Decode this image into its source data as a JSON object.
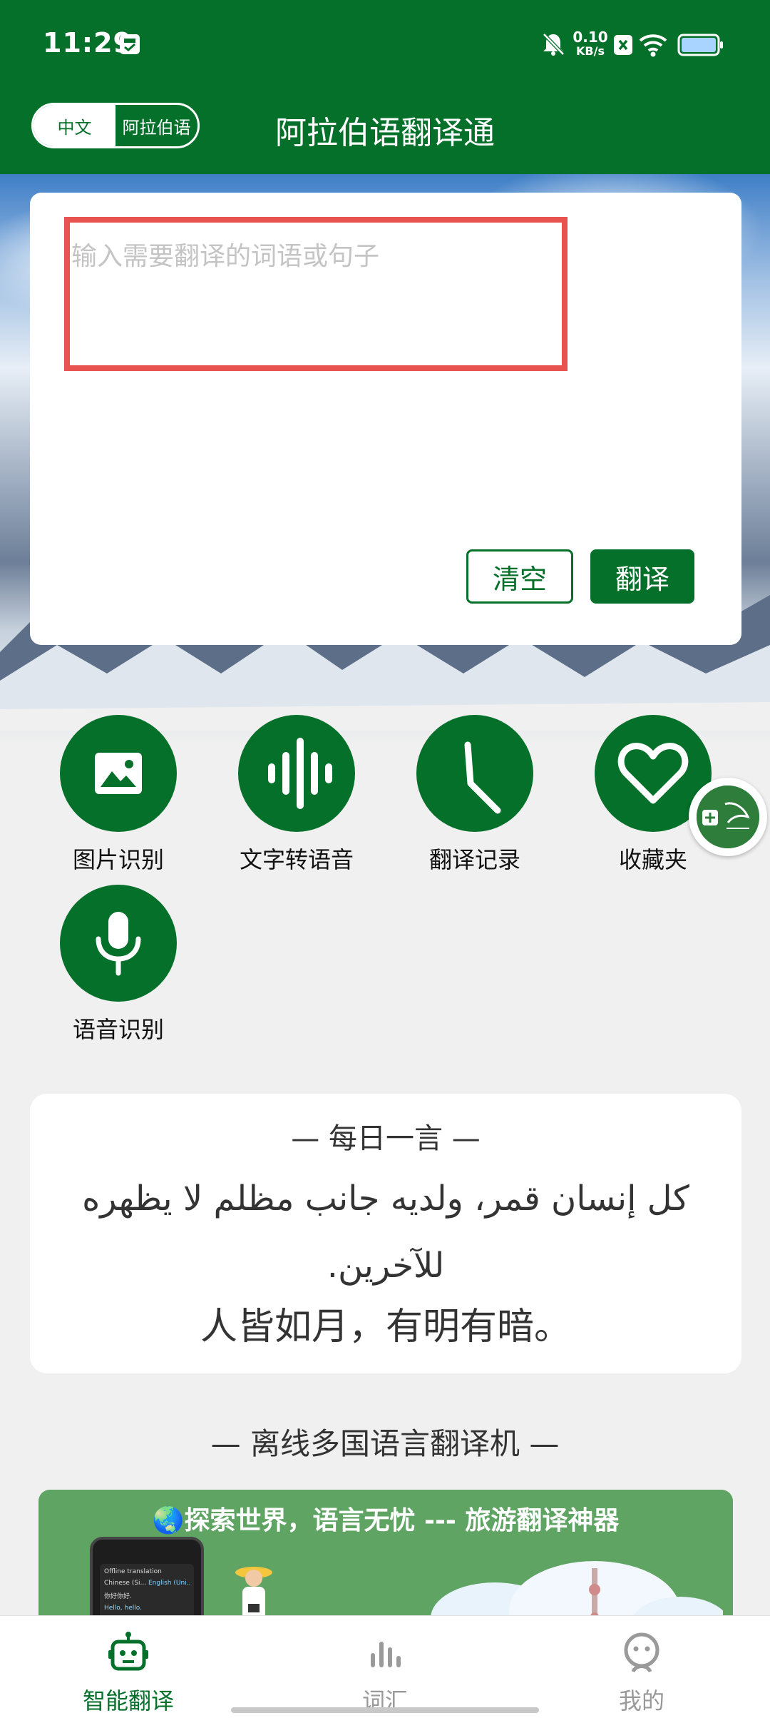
{
  "status_bar": {
    "time": "11:29",
    "net_speed_value": "0.10",
    "net_speed_unit": "KB/s"
  },
  "app_bar": {
    "lang_options": [
      "中文",
      "阿拉伯语"
    ],
    "active_lang_index": 0,
    "title": "阿拉伯语翻译通"
  },
  "input_card": {
    "placeholder": "输入需要翻译的词语或句子",
    "value": "",
    "clear_label": "清空",
    "translate_label": "翻译"
  },
  "features": [
    {
      "label": "图片识别",
      "icon": "image-icon"
    },
    {
      "label": "文字转语音",
      "icon": "soundwave-icon"
    },
    {
      "label": "翻译记录",
      "icon": "clock-icon"
    },
    {
      "label": "收藏夹",
      "icon": "heart-icon"
    },
    {
      "label": "语音识别",
      "icon": "microphone-icon"
    }
  ],
  "daily_quote": {
    "title": "— 每日一言 —",
    "arabic": "كل إنسان قمر، ولديه جانب مظلم لا يظهره للآخرين.",
    "chinese": "人皆如月，有明有暗。"
  },
  "section_title": "— 离线多国语言翻译机 —",
  "banner": {
    "text": "🌏探索世界，语言无忧 --- 旅游翻译神器",
    "device_title": "Offline translation",
    "device_lang_from": "Chinese (Si...",
    "device_lang_to": "English (Uni...",
    "device_line1": "你好你好.",
    "device_line2": "Hello, hello."
  },
  "bottom_nav": {
    "items": [
      {
        "label": "智能翻译",
        "icon": "robot-icon"
      },
      {
        "label": "词汇",
        "icon": "bar-chart-icon"
      },
      {
        "label": "我的",
        "icon": "person-icon"
      }
    ],
    "active_index": 0
  },
  "colors": {
    "brand_green": "#05702a",
    "highlight_red": "#e8534f"
  }
}
